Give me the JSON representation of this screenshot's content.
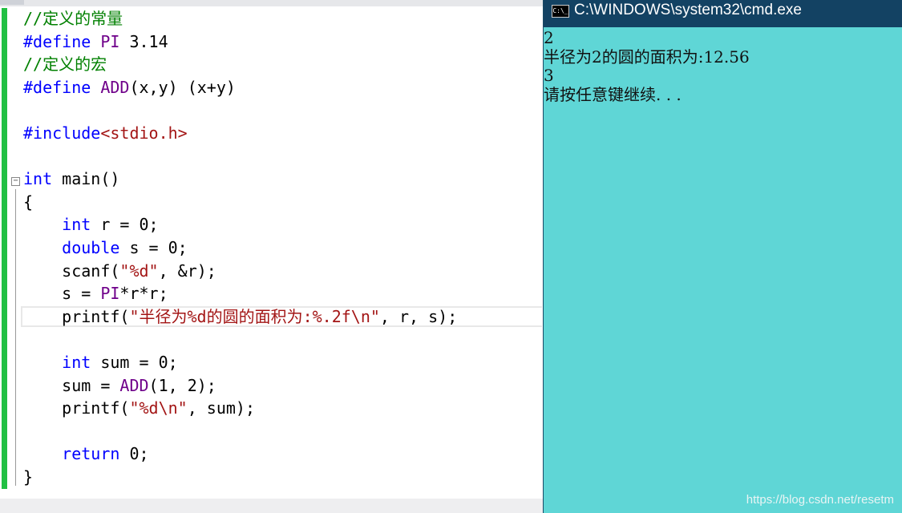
{
  "editor": {
    "lines": [
      {
        "tokens": [
          {
            "t": "//定义的常量",
            "c": "cm"
          }
        ]
      },
      {
        "tokens": [
          {
            "t": "#define ",
            "c": "kw"
          },
          {
            "t": "PI",
            "c": "mac"
          },
          {
            "t": " 3.14",
            "c": "pl"
          }
        ]
      },
      {
        "tokens": [
          {
            "t": "//定义的宏",
            "c": "cm"
          }
        ]
      },
      {
        "tokens": [
          {
            "t": "#define ",
            "c": "kw"
          },
          {
            "t": "ADD",
            "c": "mac"
          },
          {
            "t": "(x,y) (x+y)",
            "c": "pl"
          }
        ]
      },
      {
        "tokens": []
      },
      {
        "tokens": [
          {
            "t": "#include",
            "c": "kw"
          },
          {
            "t": "<stdio.h>",
            "c": "str"
          }
        ]
      },
      {
        "tokens": []
      },
      {
        "tokens": [
          {
            "t": "int",
            "c": "kw"
          },
          {
            "t": " main()",
            "c": "pl"
          }
        ]
      },
      {
        "tokens": [
          {
            "t": "{",
            "c": "pl"
          }
        ]
      },
      {
        "tokens": [
          {
            "t": "    ",
            "c": "pl"
          },
          {
            "t": "int",
            "c": "kw"
          },
          {
            "t": " r = 0;",
            "c": "pl"
          }
        ]
      },
      {
        "tokens": [
          {
            "t": "    ",
            "c": "pl"
          },
          {
            "t": "double",
            "c": "kw"
          },
          {
            "t": " s = 0;",
            "c": "pl"
          }
        ]
      },
      {
        "tokens": [
          {
            "t": "    scanf(",
            "c": "pl"
          },
          {
            "t": "\"%d\"",
            "c": "str"
          },
          {
            "t": ", &r);",
            "c": "pl"
          }
        ]
      },
      {
        "tokens": [
          {
            "t": "    s = ",
            "c": "pl"
          },
          {
            "t": "PI",
            "c": "mac"
          },
          {
            "t": "*r*r;",
            "c": "pl"
          }
        ]
      },
      {
        "tokens": [
          {
            "t": "    printf(",
            "c": "pl"
          },
          {
            "t": "\"半径为%d的圆的面积为:%.2f\\n\"",
            "c": "str"
          },
          {
            "t": ", r, s);",
            "c": "pl"
          }
        ]
      },
      {
        "tokens": []
      },
      {
        "tokens": [
          {
            "t": "    ",
            "c": "pl"
          },
          {
            "t": "int",
            "c": "kw"
          },
          {
            "t": " sum = 0;",
            "c": "pl"
          }
        ]
      },
      {
        "tokens": [
          {
            "t": "    sum = ",
            "c": "pl"
          },
          {
            "t": "ADD",
            "c": "mac"
          },
          {
            "t": "(1, 2);",
            "c": "pl"
          }
        ]
      },
      {
        "tokens": [
          {
            "t": "    printf(",
            "c": "pl"
          },
          {
            "t": "\"%d\\n\"",
            "c": "str"
          },
          {
            "t": ", sum);",
            "c": "pl"
          }
        ]
      },
      {
        "tokens": []
      },
      {
        "tokens": [
          {
            "t": "    ",
            "c": "pl"
          },
          {
            "t": "return",
            "c": "kw"
          },
          {
            "t": " 0;",
            "c": "pl"
          }
        ]
      },
      {
        "tokens": [
          {
            "t": "}",
            "c": "pl"
          }
        ]
      }
    ],
    "fold_icon": "minus-box-icon",
    "colors": {
      "keyword": "#0000ff",
      "macro": "#6f008a",
      "comment": "#008000",
      "string": "#a31515",
      "change_bar": "#21c043"
    }
  },
  "console": {
    "title": "C:\\WINDOWS\\system32\\cmd.exe",
    "icon": "cmd-icon",
    "icon_text": "C:\\_",
    "output": [
      "2",
      "半径为2的圆的面积为:12.56",
      "3",
      "请按任意键继续. . ."
    ],
    "colors": {
      "title_bar": "#134263",
      "background": "#5fd6d6"
    }
  },
  "watermark": "https://blog.csdn.net/resetm"
}
